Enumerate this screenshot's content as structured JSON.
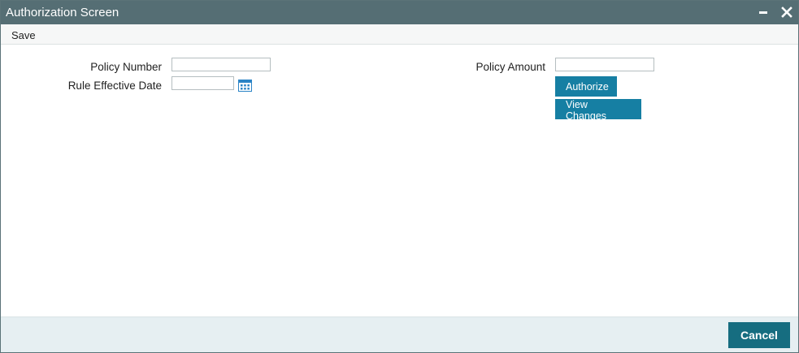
{
  "window": {
    "title": "Authorization Screen"
  },
  "menu": {
    "save_label": "Save"
  },
  "form": {
    "policy_number_label": "Policy Number",
    "policy_number_value": "",
    "rule_effective_date_label": "Rule Effective Date",
    "rule_effective_date_value": "",
    "policy_amount_label": "Policy Amount",
    "policy_amount_value": ""
  },
  "actions": {
    "authorize_label": "Authorize",
    "view_changes_label": "View Changes"
  },
  "footer": {
    "cancel_label": "Cancel"
  },
  "icons": {
    "calendar": "calendar-icon",
    "minimize": "minimize-icon",
    "close": "close-icon"
  },
  "colors": {
    "titlebar": "#556e74",
    "button": "#167fa3",
    "cancel": "#166d80",
    "footer": "#e6eff2"
  }
}
